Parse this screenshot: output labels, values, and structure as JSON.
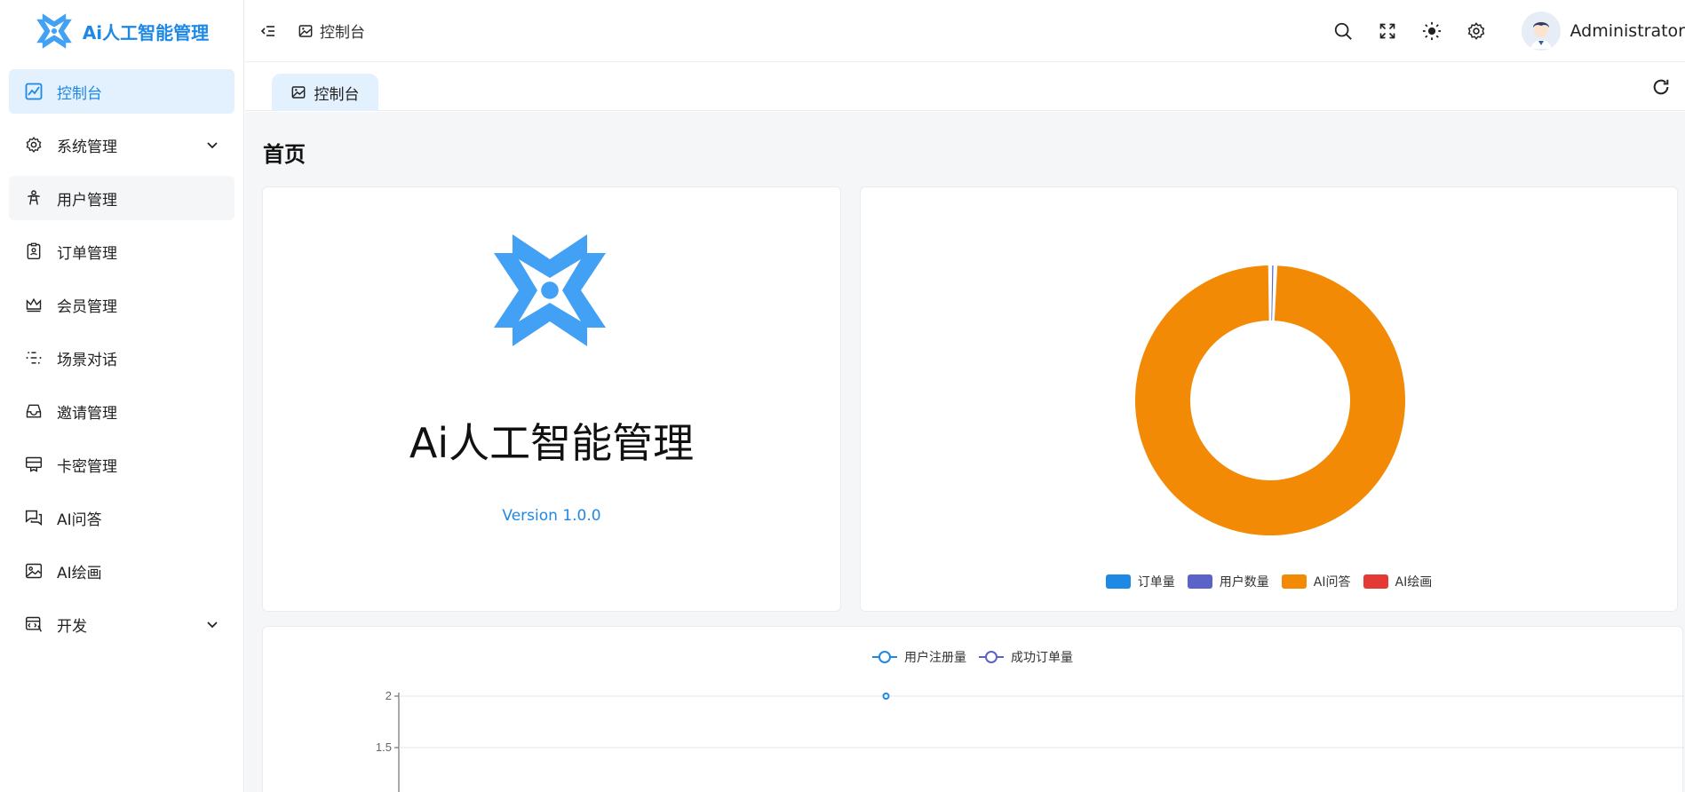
{
  "app": {
    "title": "Ai人工智能管理"
  },
  "sidebar": {
    "items": [
      {
        "label": "控制台",
        "icon": "chart-icon",
        "active": true
      },
      {
        "label": "系统管理",
        "icon": "gear-icon",
        "has_children": true
      },
      {
        "label": "用户管理",
        "icon": "user-icon"
      },
      {
        "label": "订单管理",
        "icon": "order-icon"
      },
      {
        "label": "会员管理",
        "icon": "crown-icon"
      },
      {
        "label": "场景对话",
        "icon": "scene-icon"
      },
      {
        "label": "邀请管理",
        "icon": "inbox-icon"
      },
      {
        "label": "卡密管理",
        "icon": "card-icon"
      },
      {
        "label": "AI问答",
        "icon": "chat-icon"
      },
      {
        "label": "AI绘画",
        "icon": "image-icon"
      },
      {
        "label": "开发",
        "icon": "code-icon",
        "has_children": true
      }
    ]
  },
  "header": {
    "breadcrumb": "控制台",
    "username": "Administrator"
  },
  "tabs": [
    {
      "label": "控制台"
    }
  ],
  "main": {
    "page_title": "首页",
    "brand_name": "Ai人工智能管理",
    "version": "Version 1.0.0"
  },
  "colors": {
    "accent": "#1e88e5",
    "orange": "#f28a05",
    "purple": "#5b63c9",
    "red": "#e53935"
  },
  "chart_data": [
    {
      "type": "pie",
      "style": "donut",
      "legend_position": "bottom",
      "categories": [
        "订单量",
        "用户数量",
        "AI问答",
        "AI绘画"
      ],
      "values": [
        0,
        1,
        162,
        0
      ],
      "colors": [
        "#1e88e5",
        "#5b63c9",
        "#f28a05",
        "#e53935"
      ]
    },
    {
      "type": "line",
      "legend_position": "top",
      "series": [
        {
          "name": "用户注册量",
          "color": "#1e88e5",
          "points": [
            [
              0.5,
              2
            ]
          ]
        },
        {
          "name": "成功订单量",
          "color": "#5b63c9",
          "points": []
        }
      ],
      "yticks": [
        "2",
        "1.5"
      ],
      "ylim": [
        1.5,
        2
      ]
    }
  ]
}
